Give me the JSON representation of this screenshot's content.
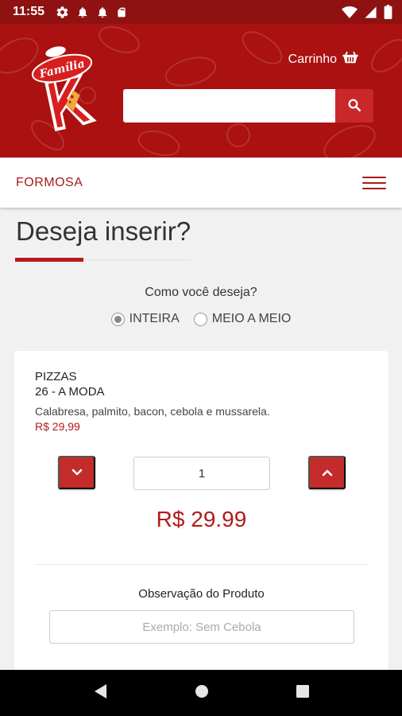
{
  "status_bar": {
    "time": "11:55",
    "left_icons": [
      "settings-icon",
      "notification-bell-icon",
      "notification-bell-icon",
      "sd-card-icon"
    ],
    "right_icons": [
      "wifi-icon",
      "cellular-signal-icon",
      "battery-icon"
    ]
  },
  "header": {
    "logo": {
      "name": "Família K",
      "text_top": "Família",
      "text_big": "K"
    },
    "cart_label": "Carrinho",
    "cart_icon": "basket-icon",
    "search": {
      "value": "",
      "placeholder": "",
      "icon": "search-icon"
    },
    "background_color": "#ab1111"
  },
  "nav": {
    "store_name": "FORMOSA",
    "menu_icon": "hamburger-menu-icon"
  },
  "page": {
    "title": "Deseja inserir?",
    "question": "Como você deseja?",
    "options": [
      {
        "label": "INTEIRA",
        "selected": true
      },
      {
        "label": "MEIO A MEIO",
        "selected": false
      }
    ]
  },
  "product": {
    "category": "PIZZAS",
    "name": "26 - A MODA",
    "description": "Calabresa, palmito, bacon, cebola e mussarela.",
    "unit_price": "R$ 29,99",
    "quantity": "1",
    "total": "R$ 29.99",
    "decrement_icon": "chevron-down-icon",
    "increment_icon": "chevron-up-icon",
    "observation_label": "Observação do Produto",
    "observation_placeholder": "Exemplo: Sem Cebola",
    "observation_value": ""
  },
  "android_nav": {
    "buttons": [
      "back-icon",
      "home-icon",
      "recents-icon"
    ]
  },
  "colors": {
    "brand_red": "#ab1111",
    "accent_red": "#c42b2b",
    "status_bar": "#8e1212"
  }
}
